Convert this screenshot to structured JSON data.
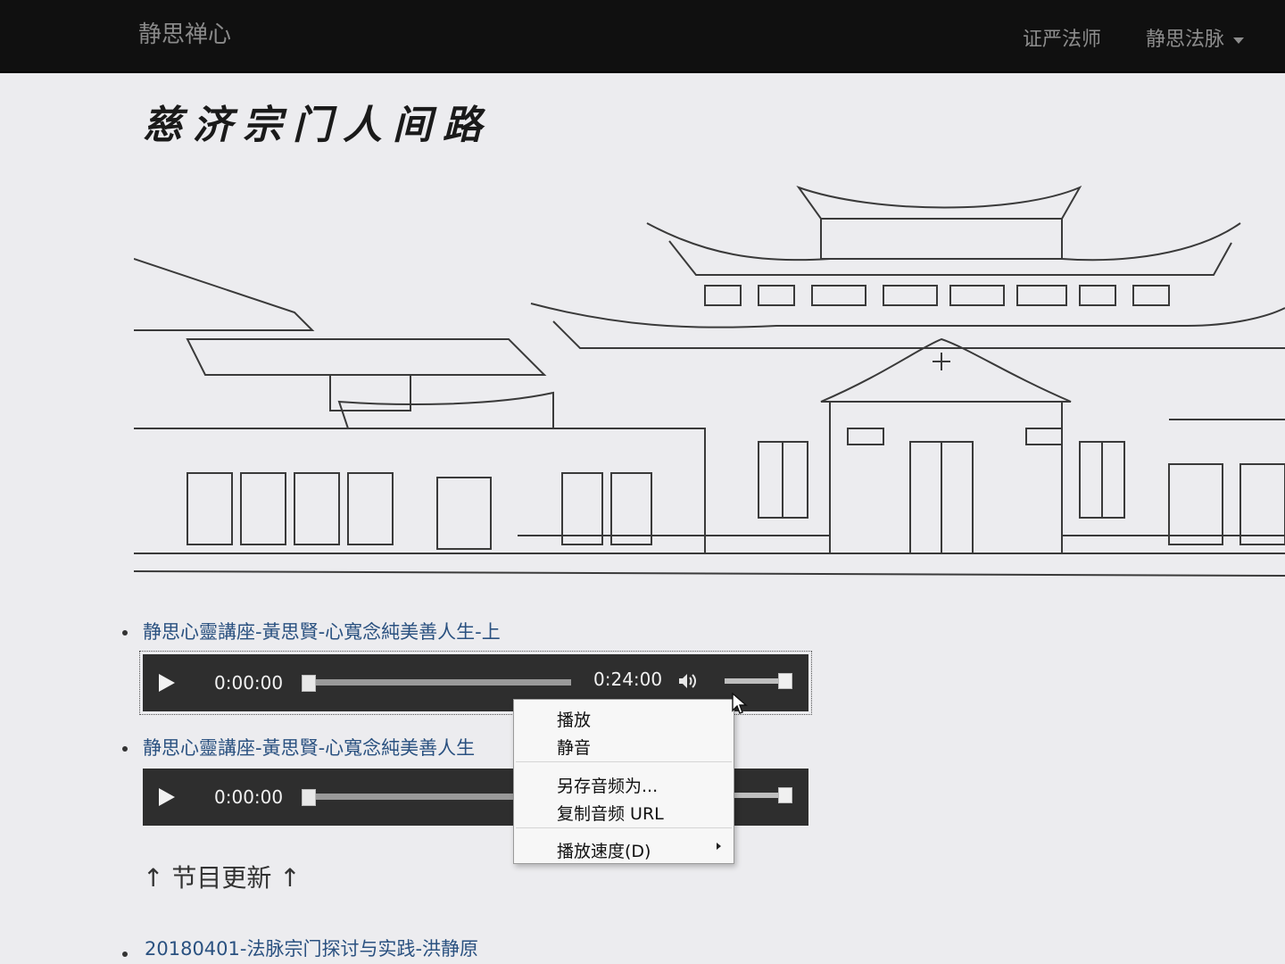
{
  "navbar": {
    "brand": "静思禅心",
    "links": [
      {
        "label": "证严法师"
      },
      {
        "label": "静思法脉",
        "has_dropdown": true
      }
    ]
  },
  "page": {
    "title": "慈济宗门人间路",
    "banner_icon": "temple-line-drawing"
  },
  "tracks": [
    {
      "title": "静思心靈講座-黃思賢-心寬念純美善人生-上",
      "current_time": "0:00:00",
      "duration": "0:24:00",
      "progress": 0,
      "volume": 1.0
    },
    {
      "title": "静思心靈講座-黃思賢-心寬念純美善人生",
      "current_time": "0:00:00",
      "progress": 0,
      "volume": 1.0
    }
  ],
  "context_menu": {
    "items": [
      "播放",
      "静音",
      "另存音频为...",
      "复制音频 URL",
      "播放速度(D)"
    ]
  },
  "section": {
    "heading": "↑ 节目更新 ↑",
    "items": [
      "20180401-法脉宗门探讨与实践-洪静原"
    ]
  },
  "colors": {
    "navbar_bg": "#101010",
    "page_bg": "#ececef",
    "link": "#2a5180",
    "player_bg": "#2e2e2e"
  }
}
